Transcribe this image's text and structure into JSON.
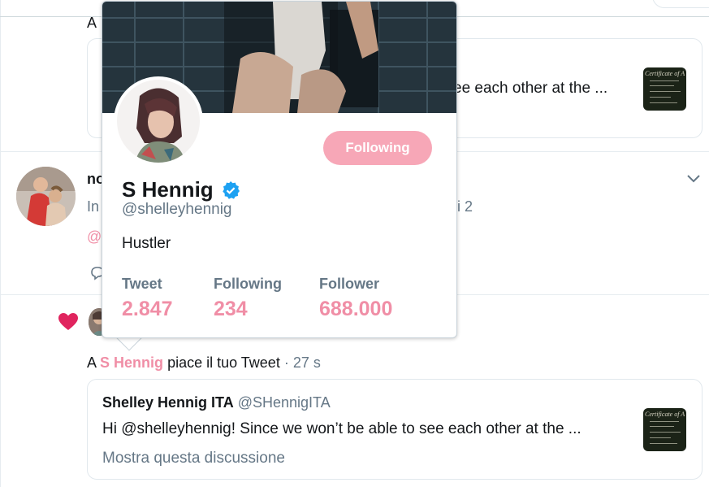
{
  "colors": {
    "accent": "#f08ea6",
    "follow_button_bg": "#f7a7b7",
    "text_primary": "#14171a",
    "text_secondary": "#657786",
    "heart": "#e0245e",
    "verified": "#1da1f2",
    "divider": "#e6ecf0"
  },
  "feed": {
    "top_item": {
      "prefix_fragment": "A",
      "quote_snippet_fragment": "ee each other at the ..."
    },
    "middle_item": {
      "name_fragment": "no",
      "line_fragment_left": "In",
      "line_fragment_right": "i 2",
      "mention_fragment": "@",
      "icons": [
        "avatar",
        "chevron-down-icon",
        "reply-icon"
      ]
    },
    "like_notification": {
      "icon": "heart-icon",
      "prefix": "A",
      "actor_name": "S Hennig",
      "action_text": "piace il tuo Tweet",
      "separator": "·",
      "time": "27 s"
    },
    "quoted_tweet": {
      "author_name": "Shelley Hennig ITA",
      "author_handle": "@SHennigITA",
      "text": "Hi @shelleyhennig! Since we won’t be able to see each other at the ...",
      "show_thread_link": "Mostra questa discussione",
      "thumbnail_title": "Certificate of A"
    }
  },
  "hovercard": {
    "display_name": "S Hennig",
    "verified_icon": "verified-badge-icon",
    "handle": "@shelleyhennig",
    "bio": "Hustler",
    "follow_button": "Following",
    "stats": [
      {
        "label": "Tweet",
        "value": "2.847"
      },
      {
        "label": "Following",
        "value": "234"
      },
      {
        "label": "Follower",
        "value": "688.000"
      }
    ]
  }
}
